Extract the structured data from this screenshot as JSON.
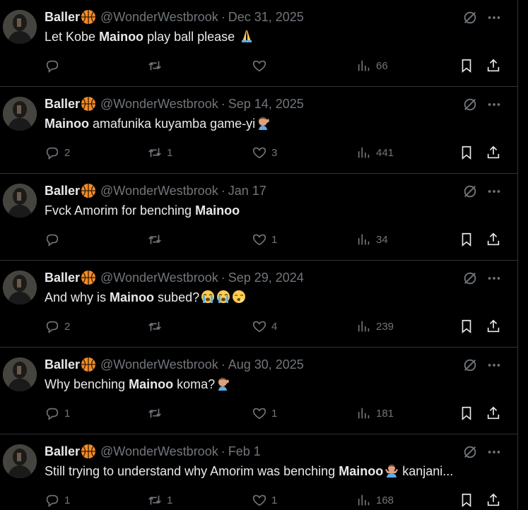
{
  "tweets": [
    {
      "name": "Baller",
      "handle": "@WonderWestbrook",
      "date": "Dec 31, 2025",
      "text_parts": [
        "Let Kobe ",
        "Mainoo",
        " play ball please "
      ],
      "emoji": "folded-hands",
      "replies": "",
      "reposts": "",
      "likes": "",
      "views": "66"
    },
    {
      "name": "Baller",
      "handle": "@WonderWestbrook",
      "date": "Sep 14, 2025",
      "text_parts": [
        "",
        "Mainoo",
        " amafunika kuyamba game-yi"
      ],
      "emoji": "facepalm",
      "replies": "2",
      "reposts": "1",
      "likes": "3",
      "views": "441"
    },
    {
      "name": "Baller",
      "handle": "@WonderWestbrook",
      "date": "Jan 17",
      "text_parts": [
        "Fvck Amorim for benching ",
        "Mainoo",
        ""
      ],
      "emoji": "",
      "replies": "",
      "reposts": "",
      "likes": "1",
      "views": "34"
    },
    {
      "name": "Baller",
      "handle": "@WonderWestbrook",
      "date": "Sep 29, 2024",
      "text_parts": [
        "And why is ",
        "Mainoo",
        " subed?"
      ],
      "emoji": "crying-crying-yawning",
      "replies": "2",
      "reposts": "",
      "likes": "4",
      "views": "239"
    },
    {
      "name": "Baller",
      "handle": "@WonderWestbrook",
      "date": "Aug 30, 2025",
      "text_parts": [
        "Why benching ",
        "Mainoo",
        " koma?"
      ],
      "emoji": "facepalm",
      "replies": "1",
      "reposts": "",
      "likes": "1",
      "views": "181"
    },
    {
      "name": "Baller",
      "handle": "@WonderWestbrook",
      "date": "Feb 1",
      "text_parts": [
        "Still trying to understand why Amorim was benching ",
        "Mainoo",
        ""
      ],
      "emoji": "shrug",
      "text_tail": " kanjani...",
      "replies": "1",
      "reposts": "1",
      "likes": "1",
      "views": "168"
    }
  ],
  "colors": {
    "background": "#000000",
    "text_primary": "#e7e9ea",
    "text_secondary": "#71767b",
    "divider": "#2f3336",
    "basketball": "#f28c28"
  },
  "icons": {
    "reply": "reply-icon",
    "repost": "repost-icon",
    "like": "heart-icon",
    "views": "views-icon",
    "bookmark": "bookmark-icon",
    "share": "share-icon",
    "grok": "grok-icon",
    "more": "more-icon",
    "basketball": "basketball-icon"
  }
}
